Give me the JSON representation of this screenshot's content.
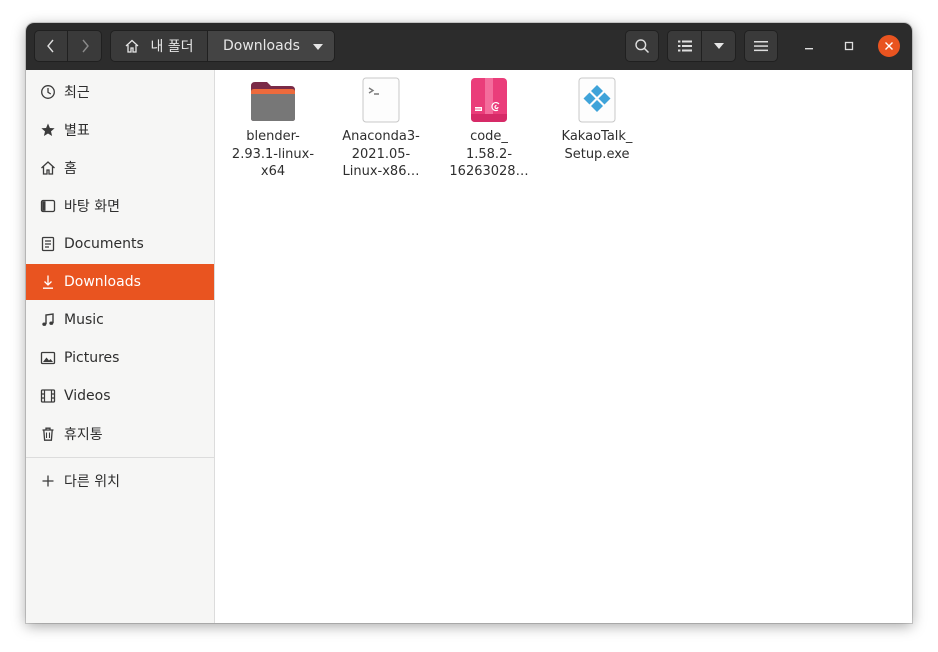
{
  "header": {
    "breadcrumb_home": "내 폴더",
    "breadcrumb_current": "Downloads"
  },
  "sidebar": {
    "items": [
      {
        "label": "최근",
        "icon": "clock-icon"
      },
      {
        "label": "별표",
        "icon": "star-icon"
      },
      {
        "label": "홈",
        "icon": "home-icon"
      },
      {
        "label": "바탕 화면",
        "icon": "desktop-icon"
      },
      {
        "label": "Documents",
        "icon": "document-icon"
      },
      {
        "label": "Downloads",
        "icon": "download-icon",
        "active": true
      },
      {
        "label": "Music",
        "icon": "music-note-icon"
      },
      {
        "label": "Pictures",
        "icon": "picture-icon"
      },
      {
        "label": "Videos",
        "icon": "film-icon"
      },
      {
        "label": "휴지통",
        "icon": "trash-icon"
      }
    ],
    "other_locations": "다른 위치"
  },
  "files": [
    {
      "name_lines": [
        "blender-",
        "2.93.1-linux-",
        "x64"
      ],
      "icon": "folder-icon"
    },
    {
      "name_lines": [
        "Anaconda3-",
        "2021.05-",
        "Linux-x86…"
      ],
      "icon": "shell-script-icon"
    },
    {
      "name_lines": [
        "code_",
        "1.58.2-",
        "16263028…"
      ],
      "icon": "deb-package-icon"
    },
    {
      "name_lines": [
        "KakaoTalk_",
        "Setup.exe"
      ],
      "icon": "exe-icon"
    }
  ],
  "colors": {
    "accent": "#e95420",
    "headerbar": "#2c2c2c",
    "sidebar": "#f6f6f5"
  }
}
